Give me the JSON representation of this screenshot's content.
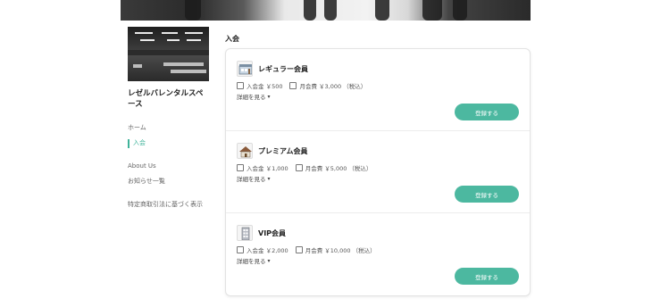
{
  "section_title": "入会",
  "sidebar": {
    "site_name": "レゼルバレンタルスペース",
    "nav": [
      {
        "label": "ホーム",
        "active": false
      },
      {
        "label": "入会",
        "active": true
      },
      {
        "label": "About Us",
        "active": false
      },
      {
        "label": "お知らせ一覧",
        "active": false
      },
      {
        "label": "特定商取引法に基づく表示",
        "active": false
      }
    ]
  },
  "plans": [
    {
      "name": "レギュラー会員",
      "entry_fee": "入会金 ￥500",
      "monthly_fee": "月会費 ￥3,000 （税込）",
      "details": "詳細を見る",
      "button": "登録する",
      "icon": "shop-icon"
    },
    {
      "name": "プレミアム会員",
      "entry_fee": "入会金 ￥1,000",
      "monthly_fee": "月会費 ￥5,000 （税込）",
      "details": "詳細を見る",
      "button": "登録する",
      "icon": "house-icon"
    },
    {
      "name": "VIP会員",
      "entry_fee": "入会金 ￥2,000",
      "monthly_fee": "月会費 ￥10,000 （税込）",
      "details": "詳細を見る",
      "button": "登録する",
      "icon": "building-icon"
    }
  ],
  "colors": {
    "accent": "#4cb8a0",
    "active_nav": "#3fb39a"
  }
}
